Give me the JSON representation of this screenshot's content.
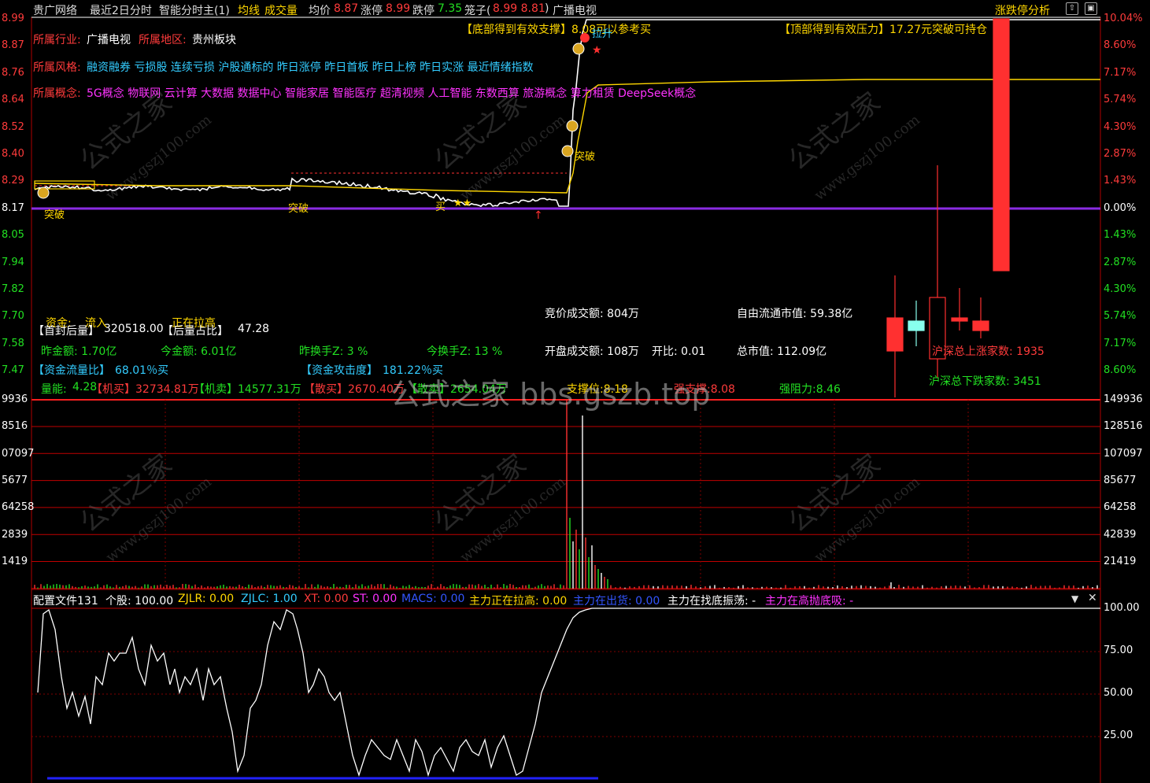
{
  "header": {
    "stock_name": "贵广网络",
    "period": "最近2日分时",
    "indicator": "智能分时主(1)",
    "avg_line_label": "均线",
    "volume_label": "成交量",
    "avg_price_label": "均价",
    "avg_price": "8.87",
    "limit_up_label": "涨停",
    "limit_up": "8.99",
    "limit_down_label": "跌停",
    "limit_down": "7.35",
    "cage_label": "笼子(",
    "cage_values": "8.99 8.81",
    "cage_close": ")",
    "sector": "广播电视",
    "right_tab": "涨跌停分析"
  },
  "colors": {
    "up": "#ff3b3b",
    "down": "#22e022",
    "yellow": "#ffd700",
    "cyan": "#3cf",
    "magenta": "#ff33ff",
    "purple_line": "#8a2be2"
  },
  "price_axis": {
    "left": [
      "8.99",
      "8.87",
      "8.76",
      "8.64",
      "8.52",
      "8.40",
      "8.29",
      "8.17",
      "8.05",
      "7.94",
      "7.82",
      "7.70",
      "7.58",
      "7.47"
    ],
    "right": [
      "10.04%",
      "8.60%",
      "7.17%",
      "5.74%",
      "4.30%",
      "2.87%",
      "1.43%",
      "0.00%",
      "1.43%",
      "2.87%",
      "4.30%",
      "5.74%",
      "7.17%",
      "8.60%"
    ]
  },
  "volume_axis": {
    "left": [
      "9936",
      "8516",
      "07097",
      "5677",
      "64258",
      "2839",
      "1419"
    ],
    "right": [
      "149936",
      "128516",
      "107097",
      "85677",
      "64258",
      "42839",
      "21419"
    ]
  },
  "osc_axis": [
    "100.00",
    "75.00",
    "50.00",
    "25.00"
  ],
  "info": {
    "industry_label": "所属行业:",
    "industry": "广播电视",
    "region_label": "所属地区:",
    "region": "贵州板块",
    "style_label": "所属风格:",
    "style": "融资融券 亏损股 连续亏损 沪股通标的 昨日涨停 昨日首板 昨日上榜 昨日实涨 最近情绪指数",
    "concept_label": "所属概念:",
    "concept": "5G概念 物联网 云计算 大数据 数据中心 智能家居 智能医疗 超清视频 人工智能 东数西算 旅游概念 算力租赁 DeepSeek概念",
    "bottom_support": "【底部得到有效支撑】8.08可以参考买",
    "top_pressure": "【顶部得到有效压力】17.27元突破可持仓"
  },
  "markers": {
    "breakthrough": "突破",
    "buy": "买",
    "pull_up": "拉升"
  },
  "stats": {
    "funds_label": "资金:",
    "funds_flow": "流入",
    "rising": "正在拉高",
    "first_seal_label": "【首封后量】",
    "first_seal": "320518.00",
    "vol_ratio_label": "【后量占比】",
    "vol_ratio": "47.28",
    "prev_amount": "昨金额: 1.70亿",
    "cur_amount": "今金额: 6.01亿",
    "prev_turnover": "昨换手Z:  3  %",
    "cur_turnover": "今换手Z:  13  %",
    "flow_ratio_label": "【资金流量比】",
    "flow_ratio": "68.01％买",
    "attack_label": "【资金攻击度】",
    "attack": "181.22％买",
    "quantity_label": "量能: ",
    "quantity": "4.28",
    "inst_buy": "【机买】32734.81万",
    "inst_sell": "【机卖】14577.31万",
    "retail_buy": "【散买】2670.40万",
    "retail_sell": "【散卖】2654.04万",
    "support": "支撑位:8.18",
    "strong_support": "强支撑:8.08",
    "strong_resist": "强阻力:8.46",
    "auction_amount": "竞价成交额: 804万",
    "open_amount": "开盘成交额: 108万",
    "open_ratio": "开比: 0.01",
    "float_cap": "自由流通市值: 59.38亿",
    "total_cap": "总市值: 112.09亿",
    "up_count": "沪深总上涨家数: 1935",
    "down_count": "沪深总下跌家数: 3451"
  },
  "osc_header": {
    "config": "配置文件131",
    "stock": "个股: 100.00",
    "zjlr": "ZJLR: 0.00",
    "zjlc": "ZJLC: 1.00",
    "xt": "XT: 0.00",
    "st": "ST: 0.00",
    "macs": "MACS: 0.00",
    "pull": "主力正在拉高: 0.00",
    "out": "主力在出货: 0.00",
    "bottom": "主力在找底振荡: -",
    "top": "主力在高抛底吸: -"
  },
  "watermark": {
    "site_top": "公式之家",
    "site_url": "www.gszj100.com",
    "center": "公式之家 bbs.gszb.top"
  }
}
